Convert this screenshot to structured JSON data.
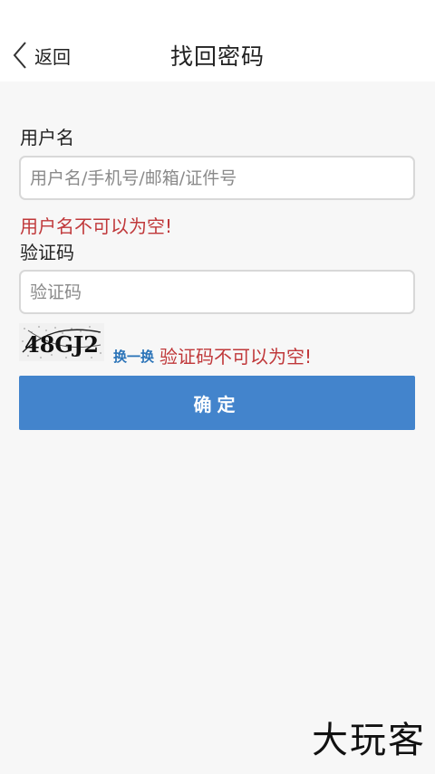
{
  "header": {
    "back_label": "返回",
    "title": "找回密码"
  },
  "form": {
    "username": {
      "label": "用户名",
      "placeholder": "用户名/手机号/邮箱/证件号",
      "value": "",
      "error": "用户名不可以为空!"
    },
    "captcha": {
      "label": "验证码",
      "placeholder": "验证码",
      "value": "",
      "image_text": "48GJ2",
      "refresh_label": "换一换",
      "error": "验证码不可以为空!"
    },
    "submit_label": "确定"
  },
  "watermark": "大玩客",
  "colors": {
    "accent": "#4384cc",
    "error": "#c0383a",
    "link": "#2a73b8",
    "background": "#f7f7f7"
  }
}
